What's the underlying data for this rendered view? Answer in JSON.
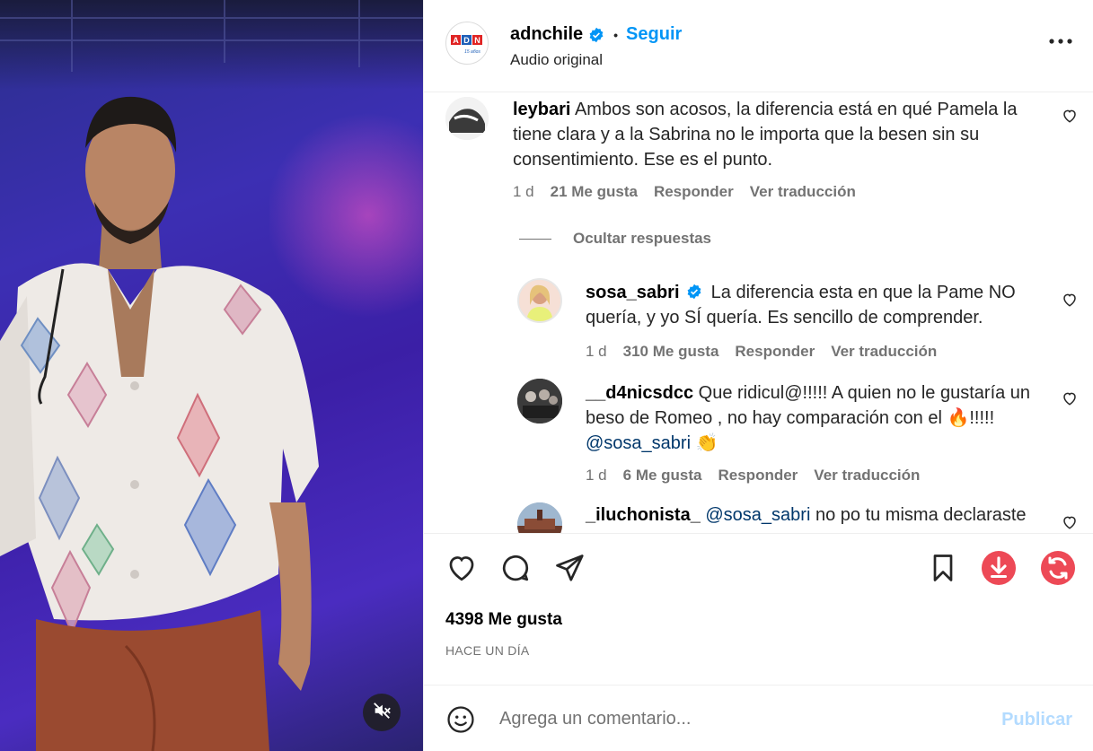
{
  "post": {
    "author": "adnchile",
    "follow_label": "Seguir",
    "dot": "•",
    "audio": "Audio original",
    "logo_text": "ADN",
    "logo_sub": "15 años"
  },
  "comments": [
    {
      "user": "leybari",
      "text": "Ambos son acosos, la diferencia está en qué Pamela la tiene clara y a la Sabrina no le importa que la besen sin su consentimiento. Ese es el punto.",
      "age": "1 d",
      "likes": "21 Me gusta",
      "reply": "Responder",
      "translate": "Ver traducción"
    }
  ],
  "hide_replies": "Ocultar respuestas",
  "replies": [
    {
      "user": "sosa_sabri",
      "verified": true,
      "text": "La diferencia esta en que la Pame NO quería, y yo SÍ quería. Es sencillo de comprender.",
      "age": "1 d",
      "likes": "310 Me gusta",
      "reply": "Responder",
      "translate": "Ver traducción"
    },
    {
      "user": "__d4nicsdcc",
      "text": "Que ridicul@!!!!! A quien no le gustaría un beso de Romeo , no hay comparación con el 🔥!!!!!",
      "mention": "@sosa_sabri",
      "emoji_end": "👏",
      "age": "1 d",
      "likes": "6 Me gusta",
      "reply": "Responder",
      "translate": "Ver traducción"
    },
    {
      "user": "_iluchonista_",
      "mention": "@sosa_sabri",
      "text": "no po tu misma declaraste"
    }
  ],
  "stats": {
    "likes": "4398 Me gusta",
    "time": "HACE UN DÍA"
  },
  "composer": {
    "placeholder": "Agrega un comentario...",
    "post_label": "Publicar"
  },
  "colors": {
    "accent": "#0095f6",
    "download": "#ed4956",
    "post_disabled": "#b3dbff"
  },
  "icons": [
    "heart-icon",
    "comment-icon",
    "share-icon",
    "bookmark-icon",
    "download-icon",
    "refresh-icon",
    "emoji-icon",
    "more-icon",
    "mute-icon",
    "verified-icon"
  ]
}
